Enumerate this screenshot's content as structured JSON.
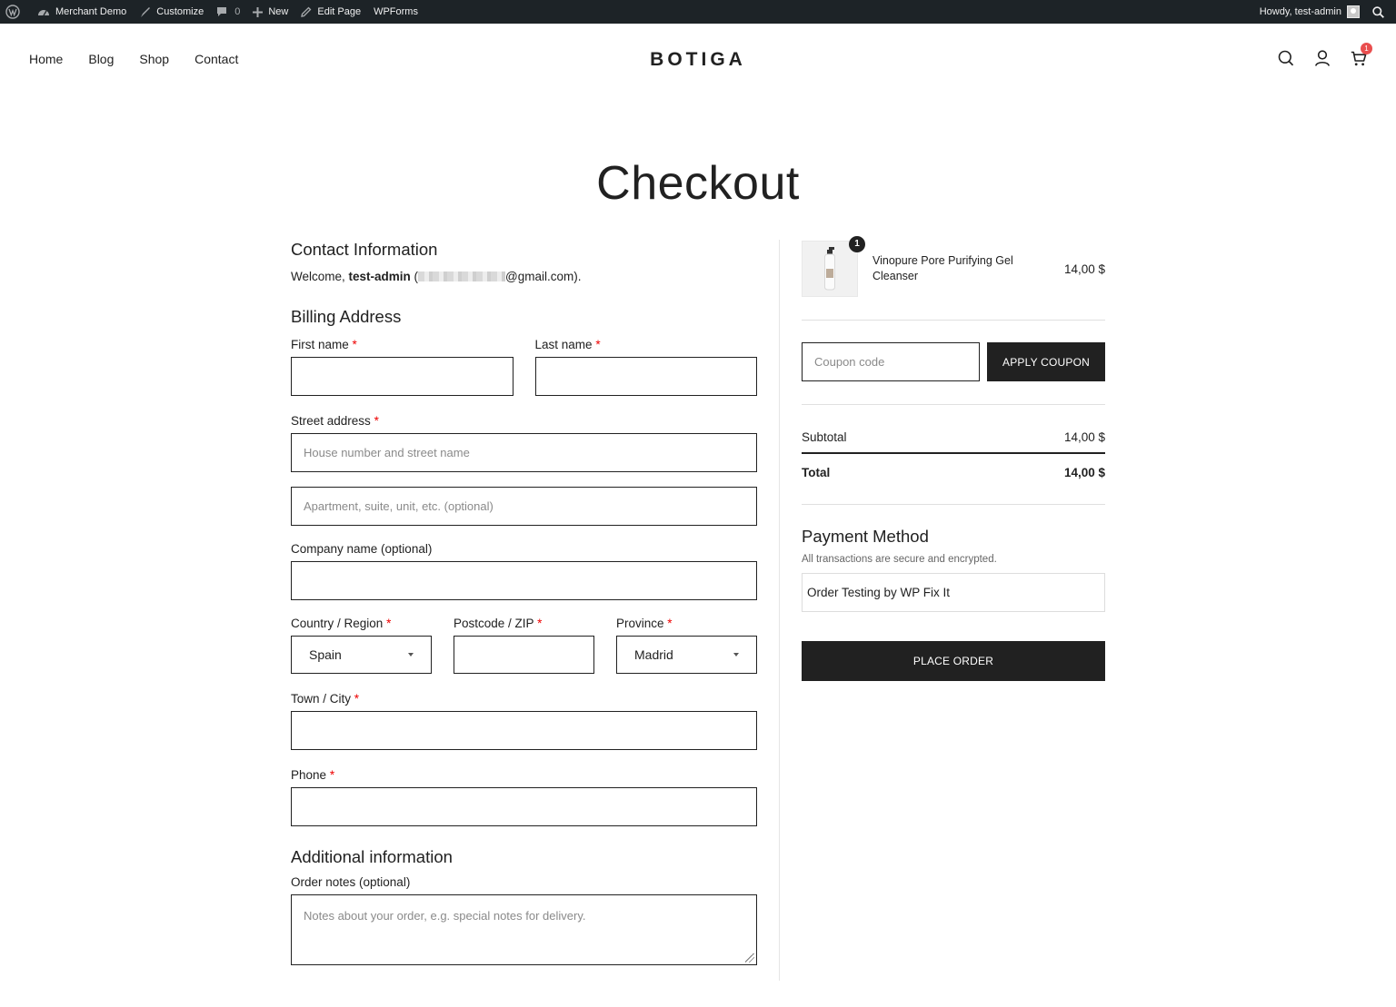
{
  "adminbar": {
    "site": "Merchant Demo",
    "customize": "Customize",
    "comments_count": "0",
    "new": "New",
    "edit_page": "Edit Page",
    "wpforms": "WPForms",
    "howdy": "Howdy, test-admin"
  },
  "header": {
    "nav": [
      "Home",
      "Blog",
      "Shop",
      "Contact"
    ],
    "logo": "BOTIGA",
    "cart_count": "1"
  },
  "page_title": "Checkout",
  "contact": {
    "heading": "Contact Information",
    "welcome_prefix": "Welcome, ",
    "username": "test-admin",
    "email_open": " (",
    "email_suffix": "@gmail.com)."
  },
  "billing": {
    "heading": "Billing Address",
    "first_name_label": "First name",
    "last_name_label": "Last name",
    "street_label": "Street address",
    "street_placeholder": "House number and street name",
    "street2_placeholder": "Apartment, suite, unit, etc. (optional)",
    "company_label": "Company name (optional)",
    "country_label": "Country / Region",
    "country_value": "Spain",
    "postcode_label": "Postcode / ZIP",
    "province_label": "Province",
    "province_value": "Madrid",
    "city_label": "Town / City",
    "phone_label": "Phone",
    "required_mark": "*"
  },
  "additional": {
    "heading": "Additional information",
    "notes_label": "Order notes (optional)",
    "notes_placeholder": "Notes about your order, e.g. special notes for delivery."
  },
  "order": {
    "item_qty": "1",
    "item_name": "Vinopure Pore Purifying Gel Cleanser",
    "item_price": "14,00 $",
    "coupon_placeholder": "Coupon code",
    "apply_coupon": "APPLY COUPON",
    "subtotal_label": "Subtotal",
    "subtotal_value": "14,00 $",
    "total_label": "Total",
    "total_value": "14,00 $"
  },
  "payment": {
    "heading": "Payment Method",
    "subtext": "All transactions are secure and encrypted.",
    "method": "Order Testing by WP Fix It",
    "place_order": "PLACE ORDER"
  }
}
